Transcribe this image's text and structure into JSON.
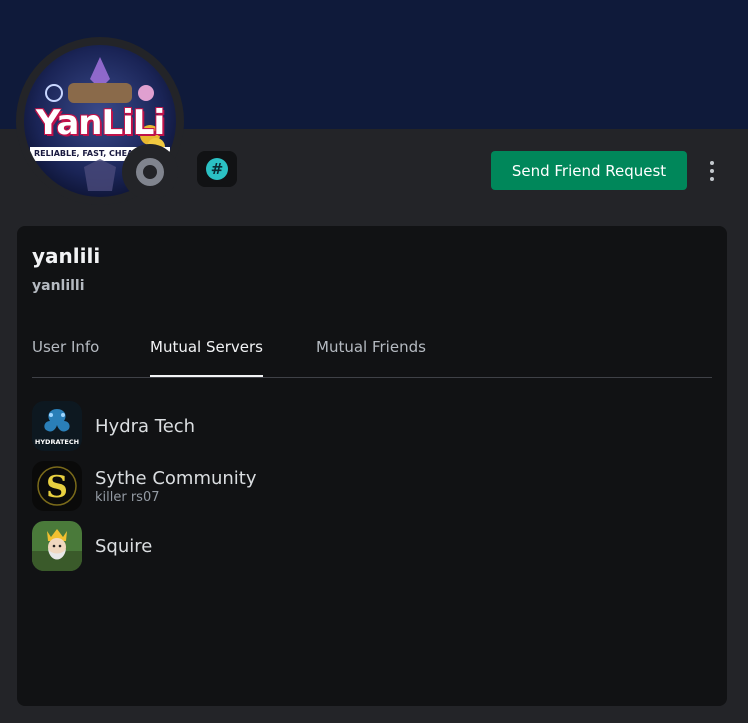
{
  "profile": {
    "display_name": "yanlili",
    "username": "yanlilli",
    "avatar_logo_text": "YanLiLi",
    "avatar_tagline": "RELIABLE, FAST, CHEAP",
    "status_icon": "offline-status-icon",
    "badge_icon": "hashtag-badge-icon",
    "badge_glyph": "#"
  },
  "actions": {
    "send_friend_request_label": "Send Friend Request",
    "more_icon": "vertical-ellipsis-icon"
  },
  "tabs": [
    {
      "label": "User Info",
      "active": false
    },
    {
      "label": "Mutual Servers",
      "active": true
    },
    {
      "label": "Mutual Friends",
      "active": false
    }
  ],
  "mutual_servers": [
    {
      "name": "Hydra Tech",
      "nickname": "",
      "icon": "hydra-tech-server-icon",
      "icon_text": "HYDRATECH"
    },
    {
      "name": "Sythe Community",
      "nickname": "killer rs07",
      "icon": "sythe-server-icon",
      "icon_text": "S"
    },
    {
      "name": "Squire",
      "nickname": "",
      "icon": "squire-server-icon",
      "icon_text": ""
    }
  ],
  "colors": {
    "banner": "#0f1a3a",
    "background": "#232428",
    "card": "#111214",
    "accent_button": "#00875a",
    "badge": "#2bc1c4",
    "status_offline": "#80848e"
  }
}
